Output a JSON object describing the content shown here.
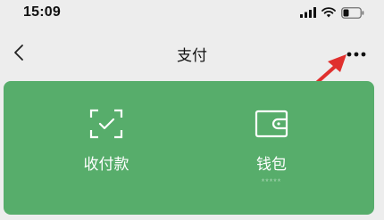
{
  "status_bar": {
    "time": "15:09",
    "icons": [
      "cellular-signal-icon",
      "wifi-icon",
      "battery-icon"
    ]
  },
  "nav": {
    "title": "支付",
    "back_icon": "back-chevron-icon",
    "more_icon": "more-dots-icon"
  },
  "annotation": {
    "type": "arrow",
    "color": "#e0302e",
    "points_to": "more-button"
  },
  "pay_panel": {
    "background": "#57ad6b",
    "actions": [
      {
        "label": "收付款",
        "icon": "scan-check-icon"
      },
      {
        "label": "钱包",
        "icon": "wallet-icon",
        "balance": "*****"
      }
    ]
  }
}
